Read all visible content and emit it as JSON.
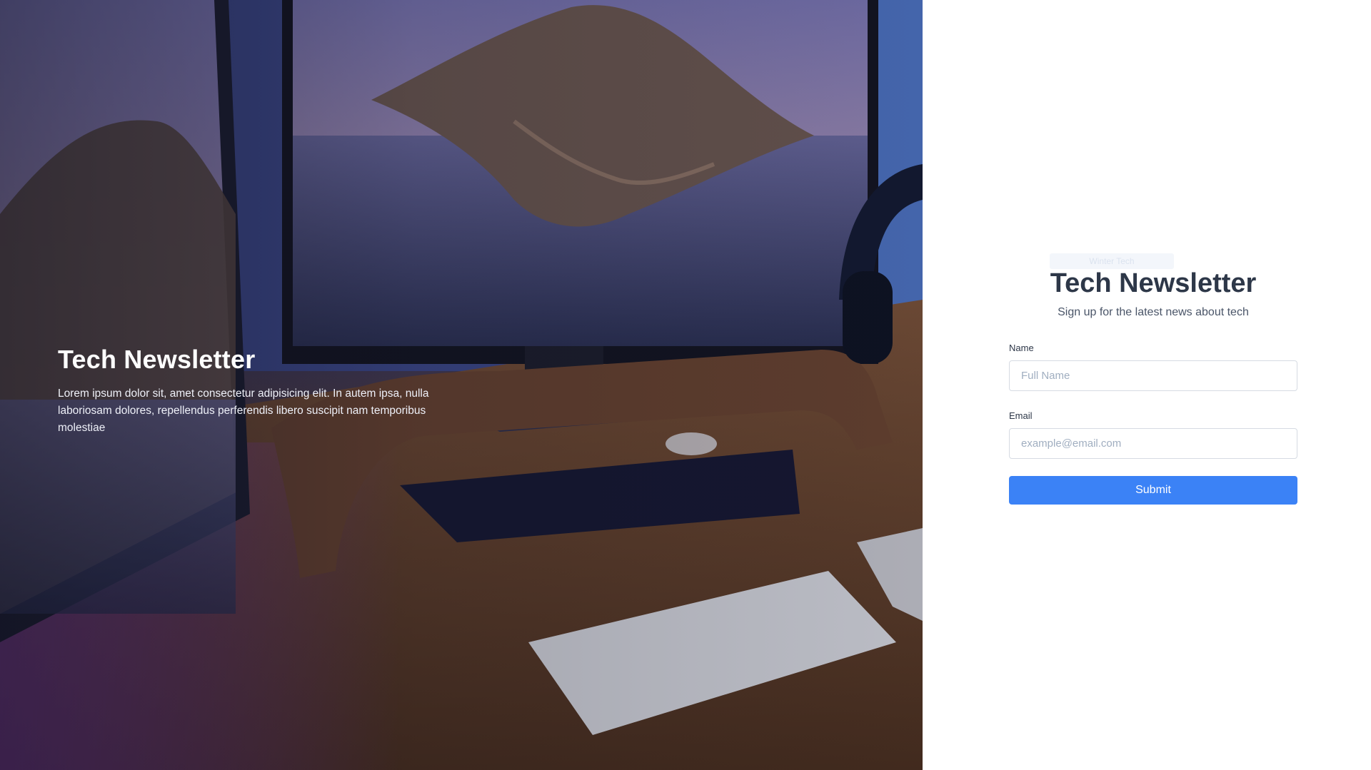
{
  "hero": {
    "title": "Tech Newsletter",
    "description": "Lorem ipsum dolor sit, amet consectetur adipisicing elit. In autem ipsa, nulla laboriosam dolores, repellendus perferendis libero suscipit nam temporibus molestiae"
  },
  "form": {
    "logo_text": "Winter Tech",
    "title": "Tech Newsletter",
    "subtitle": "Sign up for the latest news about tech",
    "name": {
      "label": "Name",
      "placeholder": "Full Name",
      "value": ""
    },
    "email": {
      "label": "Email",
      "placeholder": "example@email.com",
      "value": ""
    },
    "submit_label": "Submit"
  },
  "colors": {
    "accent": "#3b82f6",
    "heading": "#2d3748",
    "muted": "#4a5568"
  },
  "icons": [
    "desk-setup-photo"
  ]
}
